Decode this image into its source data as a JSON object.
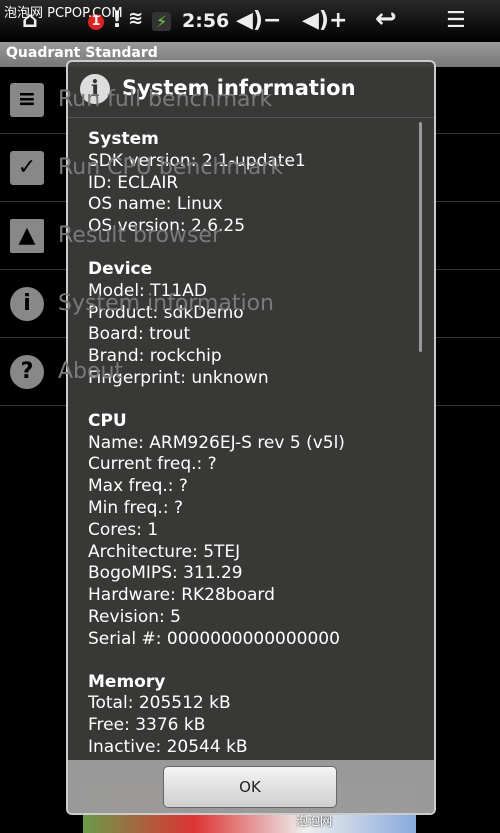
{
  "watermark": "泡泡网 PCPOP.COM",
  "watermark2": "泡泡网",
  "status": {
    "time": "2:56",
    "notification_count": "1"
  },
  "app_title": "Quadrant Standard",
  "menu": [
    {
      "label": "Run full benchmark",
      "icon": "bars-icon"
    },
    {
      "label": "Run CPU benchmark",
      "icon": "checklist-icon"
    },
    {
      "label": "Result browser",
      "icon": "image-icon"
    },
    {
      "label": "System information",
      "icon": "info-icon"
    },
    {
      "label": "About",
      "icon": "help-icon"
    }
  ],
  "dialog": {
    "title": "System information",
    "sections": [
      {
        "title": "System",
        "lines": [
          "SDK version: 2.1-update1",
          "ID: ECLAIR",
          "OS name: Linux",
          "OS version: 2.6.25"
        ]
      },
      {
        "title": "Device",
        "lines": [
          "Model: T11AD",
          "Product: sdkDemo",
          "Board: trout",
          "Brand: rockchip",
          "Fingerprint: unknown"
        ]
      },
      {
        "title": "CPU",
        "lines": [
          "Name: ARM926EJ-S rev 5 (v5l)",
          "Current freq.: ?",
          "Max freq.: ?",
          "Min freq.: ?",
          "Cores: 1",
          "Architecture: 5TEJ",
          "BogoMIPS: 311.29",
          "Hardware: RK28board",
          "Revision: 5",
          "Serial #: 0000000000000000"
        ]
      },
      {
        "title": "Memory",
        "lines": [
          "Total: 205512 kB",
          "Free: 3376 kB",
          "Inactive: 20544 kB"
        ]
      }
    ],
    "ok_label": "OK"
  }
}
